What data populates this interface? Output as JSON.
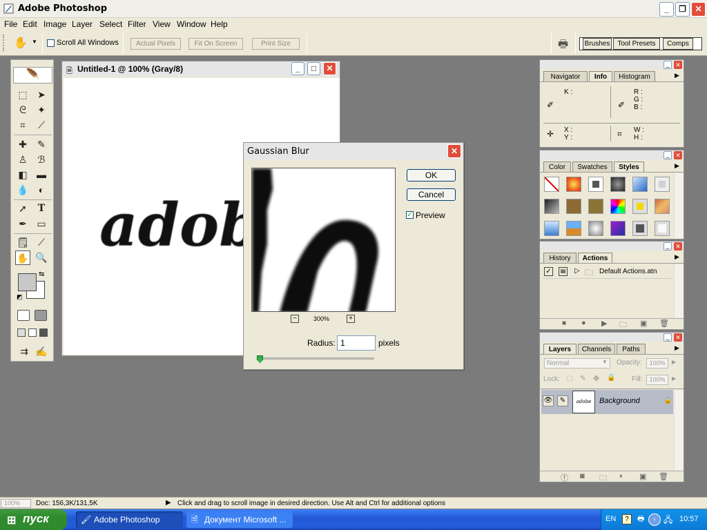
{
  "app": {
    "title": "Adobe Photoshop"
  },
  "menu": [
    "File",
    "Edit",
    "Image",
    "Layer",
    "Select",
    "Filter",
    "View",
    "Window",
    "Help"
  ],
  "options": {
    "scroll_all_windows": "Scroll All Windows",
    "actual_pixels": "Actual Pixels",
    "fit_on_screen": "Fit On Screen",
    "print_size": "Print Size",
    "well_tabs": [
      "Brushes",
      "Tool Presets",
      "Comps"
    ]
  },
  "document": {
    "title": "Untitled-1 @ 100% (Gray/8)",
    "canvas_text": "adob"
  },
  "dialog": {
    "title": "Gaussian Blur",
    "ok": "OK",
    "cancel": "Cancel",
    "preview": "Preview",
    "preview_checked": true,
    "zoom": "300%",
    "radius_label": "Radius:",
    "radius_value": "1",
    "radius_unit": "pixels",
    "radius_slider_level": 0.01
  },
  "info_panel": {
    "tabs": [
      "Navigator",
      "Info",
      "Histogram"
    ],
    "active_tab": "Info",
    "k": "K :",
    "r": "R :",
    "g": "G :",
    "b": "B :",
    "x": "X :",
    "y": "Y :",
    "w": "W :",
    "h": "H :"
  },
  "styles_panel": {
    "tabs": [
      "Color",
      "Swatches",
      "Styles"
    ],
    "active_tab": "Styles"
  },
  "actions_panel": {
    "tabs": [
      "History",
      "Actions"
    ],
    "active_tab": "Actions",
    "items": [
      "Default Actions.atn"
    ]
  },
  "layers_panel": {
    "tabs": [
      "Layers",
      "Channels",
      "Paths"
    ],
    "active_tab": "Layers",
    "blend_mode": "Normal",
    "opacity_label": "Opacity:",
    "opacity_value": "100%",
    "lock_label": "Lock:",
    "fill_label": "Fill:",
    "fill_value": "100%",
    "layers": [
      {
        "name": "Background",
        "thumb_text": "adobe"
      }
    ]
  },
  "status": {
    "zoom": "100%",
    "doc": "Doc: 156,3K/131,5K",
    "message": "Click and drag to scroll image in desired direction.  Use Alt and Ctrl for additional options"
  },
  "taskbar": {
    "start": "пуск",
    "tasks": [
      "Adobe Photoshop",
      "Документ Microsoft ..."
    ],
    "lang": "EN",
    "clock": "10:57"
  },
  "colors": {
    "accent_red": "#e14d3a",
    "taskbar_blue": "#245ddb",
    "start_green": "#3a9a37",
    "panel_bg": "#ece9d8"
  }
}
